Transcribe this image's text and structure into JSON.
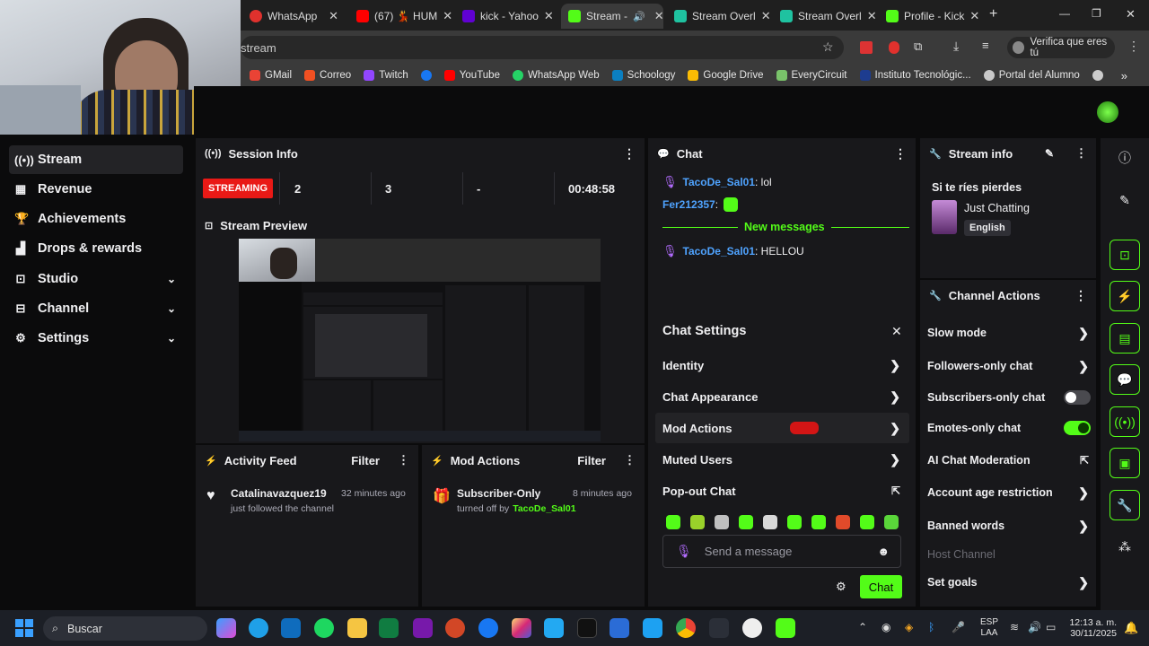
{
  "browser": {
    "tabs": [
      {
        "label": "WhatsApp",
        "color": "#e0312d"
      },
      {
        "label": "(67) 💃 HUM",
        "color": "#ff0000"
      },
      {
        "label": "kick - Yahoo",
        "color": "#6001d2"
      },
      {
        "label": "Stream -",
        "color": "#53fc18"
      },
      {
        "label": "Stream Overl",
        "color": "#1fc2a0"
      },
      {
        "label": "Stream Overl",
        "color": "#1fc2a0"
      },
      {
        "label": "Profile - Kick",
        "color": "#53fc18"
      }
    ],
    "url": "stream",
    "verify_label": "Verifica que eres tú",
    "bookmarks": [
      {
        "label": "GMail",
        "color": "#ea4335"
      },
      {
        "label": "Correo",
        "color": "#f25022"
      },
      {
        "label": "Twitch",
        "color": "#9146ff"
      },
      {
        "label": "",
        "color": "#1877f2"
      },
      {
        "label": "YouTube",
        "color": "#ff0000"
      },
      {
        "label": "WhatsApp Web",
        "color": "#25d366"
      },
      {
        "label": "Schoology",
        "color": "#0b7fc1"
      },
      {
        "label": "Google Drive",
        "color": "#fbbc04"
      },
      {
        "label": "EveryCircuit",
        "color": "#79c36a"
      },
      {
        "label": "Instituto Tecnológic...",
        "color": "#1d3c8f"
      },
      {
        "label": "Portal del Alumno",
        "color": "#c9c9c9"
      }
    ]
  },
  "sidebar": {
    "items": [
      {
        "label": "Stream",
        "icon": "broadcast-icon"
      },
      {
        "label": "Revenue",
        "icon": "bank-icon"
      },
      {
        "label": "Achievements",
        "icon": "trophy-icon"
      },
      {
        "label": "Drops & rewards",
        "icon": "gift-icon"
      },
      {
        "label": "Studio",
        "icon": "studio-icon"
      },
      {
        "label": "Channel",
        "icon": "channel-icon"
      },
      {
        "label": "Settings",
        "icon": "gear-icon"
      }
    ]
  },
  "session": {
    "title": "Session Info",
    "status": "STREAMING",
    "viewers": "2",
    "followers": "3",
    "extra": "-",
    "uptime": "00:48:58"
  },
  "preview": {
    "title": "Stream Preview"
  },
  "activity": {
    "title": "Activity Feed",
    "filter": "Filter",
    "user": "Catalinavazquez19",
    "time": "32 minutes ago",
    "action": "just followed the channel"
  },
  "mod": {
    "title": "Mod Actions",
    "filter": "Filter",
    "event": "Subscriber-Only",
    "time": "8 minutes ago",
    "action_prefix": "turned off by",
    "moderator": "TacoDe_Sal01"
  },
  "chat": {
    "title": "Chat",
    "messages": [
      {
        "user": "TacoDe_Sal01",
        "text": ": lol"
      },
      {
        "user": "Fer212357",
        "text": ":"
      },
      {
        "user": "TacoDe_Sal01",
        "text": ": HELLOU"
      }
    ],
    "new_messages": "New messages",
    "settings_title": "Chat Settings",
    "settings": [
      "Identity",
      "Chat Appearance",
      "Mod Actions",
      "Muted Users",
      "Pop-out Chat"
    ],
    "input_placeholder": "Send a message",
    "send_label": "Chat"
  },
  "stream_info": {
    "title": "Stream info",
    "stream_title": "Si te ríes pierdes",
    "category": "Just Chatting",
    "language": "English"
  },
  "channel_actions": {
    "title": "Channel Actions",
    "slow_mode": "Slow mode",
    "followers_only": "Followers-only chat",
    "subscribers_only": "Subscribers-only chat",
    "subscribers_only_on": false,
    "emotes_only": "Emotes-only chat",
    "emotes_only_on": true,
    "ai_moderation": "AI Chat Moderation",
    "age_restriction": "Account age restriction",
    "banned_words": "Banned words",
    "host_channel": "Host Channel",
    "set_goals": "Set goals"
  },
  "taskbar": {
    "search": "Buscar",
    "lang1": "ESP",
    "lang2": "LAA",
    "time": "12:13 a. m.",
    "date": "30/11/2025"
  },
  "accent": "#53fc18"
}
